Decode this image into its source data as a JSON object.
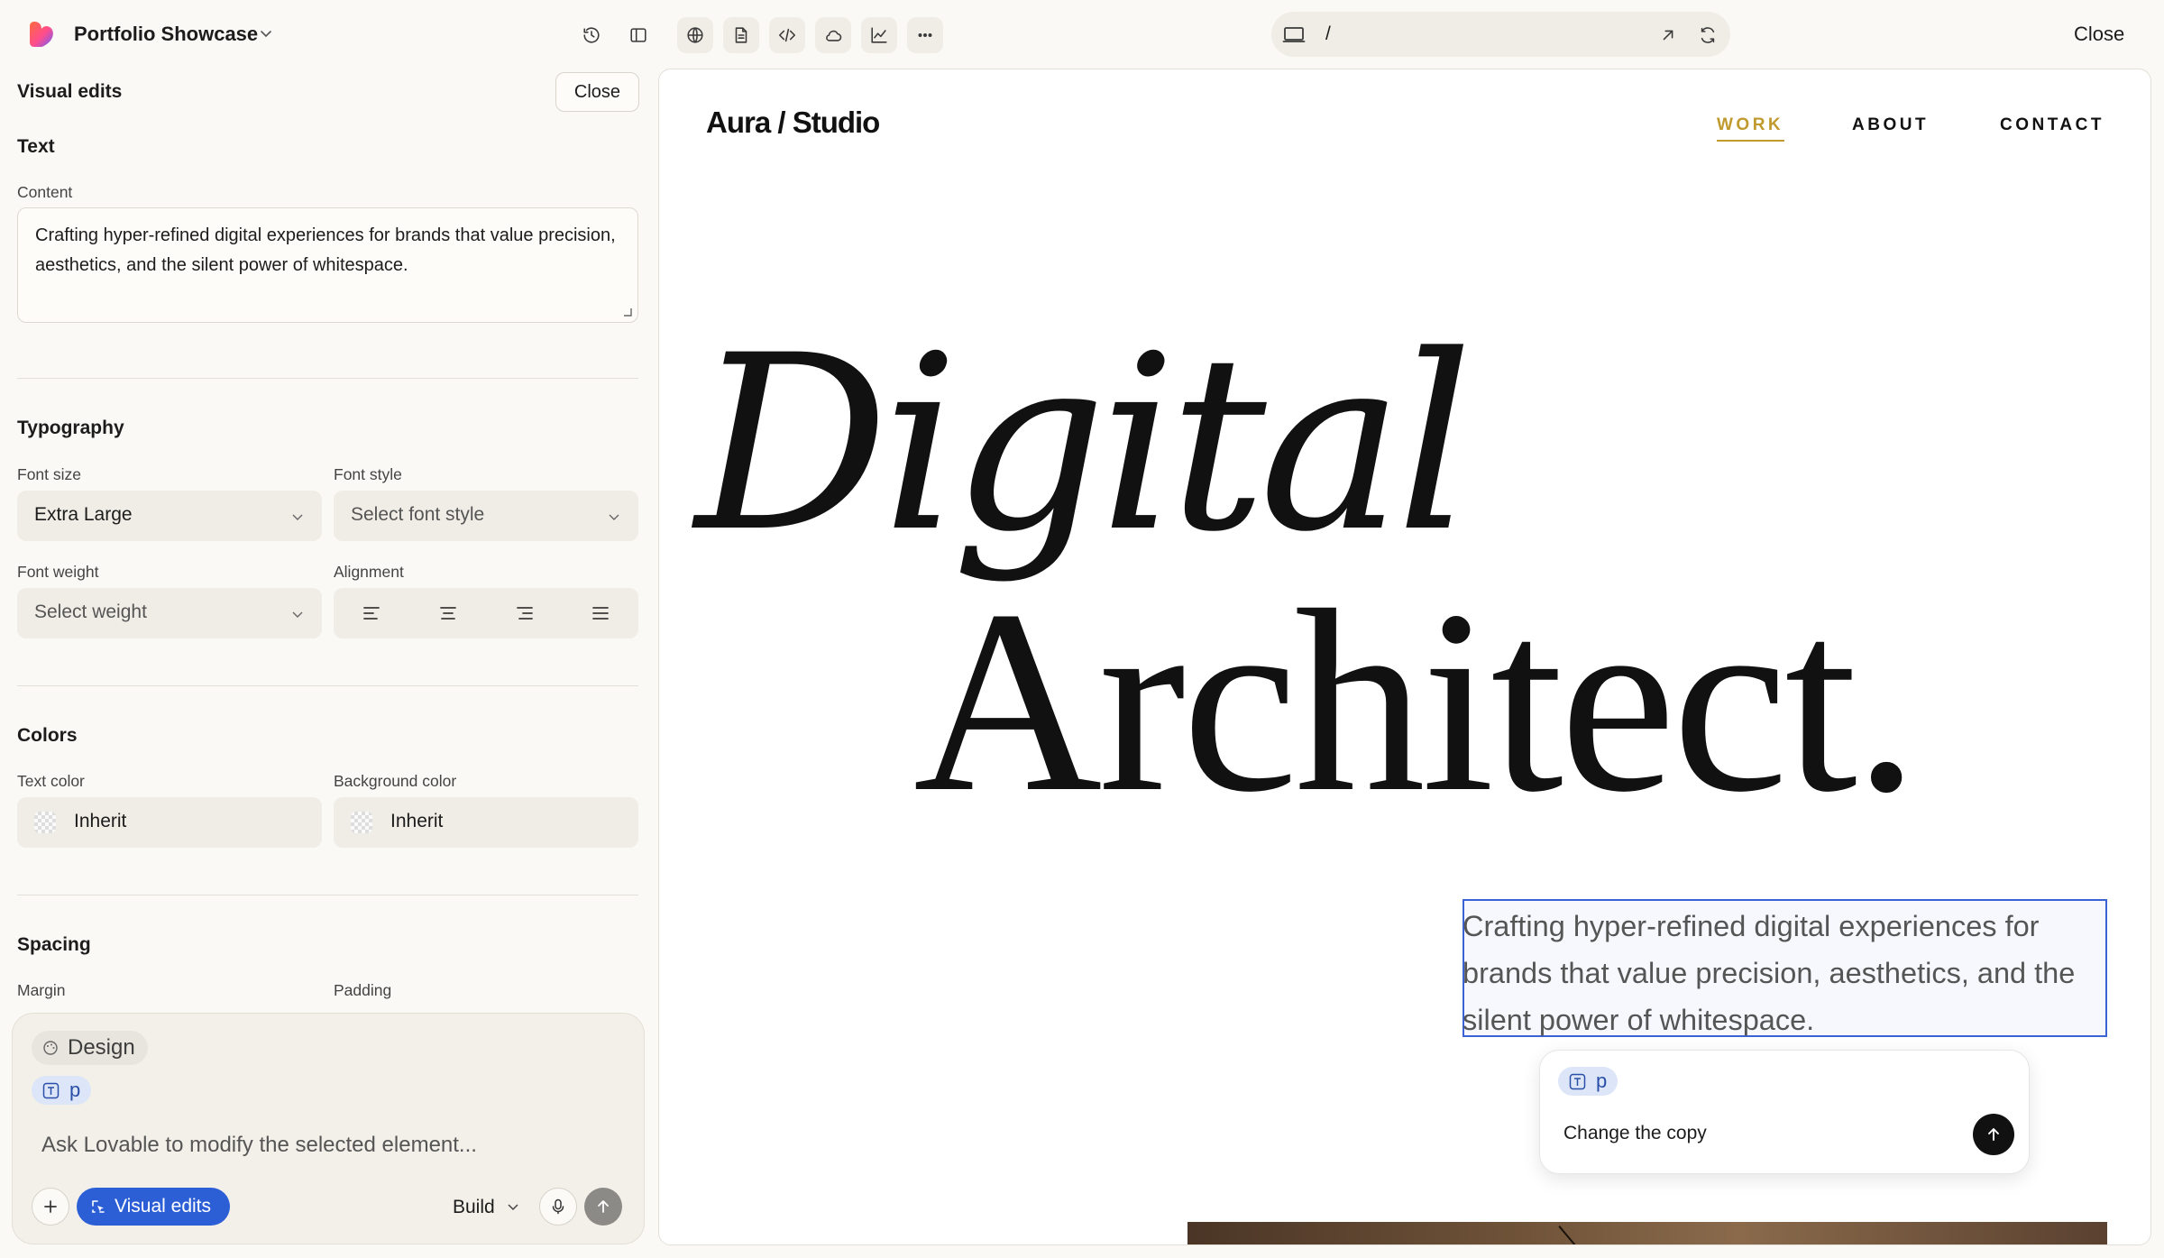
{
  "app": {
    "project_name": "Portfolio Showcase",
    "url_path": "/",
    "close_label": "Close"
  },
  "toolbar": {
    "icons": [
      "history-icon",
      "sidebar-toggle-icon",
      "globe-icon",
      "file-icon",
      "code-icon",
      "cloud-icon",
      "analytics-icon",
      "more-icon"
    ]
  },
  "panel": {
    "title": "Visual edits",
    "close_label": "Close",
    "text_section": {
      "title": "Text",
      "content_label": "Content",
      "content_value": "Crafting hyper-refined digital experiences for brands that value precision, aesthetics, and the silent power of whitespace."
    },
    "typography": {
      "title": "Typography",
      "font_size_label": "Font size",
      "font_size_value": "Extra Large",
      "font_style_label": "Font style",
      "font_style_placeholder": "Select font style",
      "font_weight_label": "Font weight",
      "font_weight_placeholder": "Select weight",
      "alignment_label": "Alignment",
      "alignment_options": [
        "left",
        "center",
        "right",
        "justify"
      ]
    },
    "colors": {
      "title": "Colors",
      "text_color_label": "Text color",
      "text_color_value": "Inherit",
      "bg_color_label": "Background color",
      "bg_color_value": "Inherit"
    },
    "spacing": {
      "title": "Spacing",
      "margin_label": "Margin",
      "padding_label": "Padding"
    }
  },
  "composer": {
    "design_chip": "Design",
    "element_chip": "p",
    "placeholder": "Ask Lovable to modify the selected element...",
    "visual_edits_label": "Visual edits",
    "mode_label": "Build"
  },
  "preview": {
    "brand": "Aura / Studio",
    "nav": [
      "WORK",
      "ABOUT",
      "CONTACT"
    ],
    "active_nav": "WORK",
    "hero_line1": "Digital",
    "hero_line2": "Architect.",
    "hero_copy": "Crafting hyper-refined digital experiences for brands that value precision, aesthetics, and the silent power of whitespace.",
    "popup": {
      "element_chip": "p",
      "text": "Change the copy"
    }
  },
  "colors": {
    "accent_blue": "#2c5fd6",
    "nav_active": "#c09a2e",
    "selection_border": "#3b63d6",
    "app_background": "#faf9f5"
  }
}
